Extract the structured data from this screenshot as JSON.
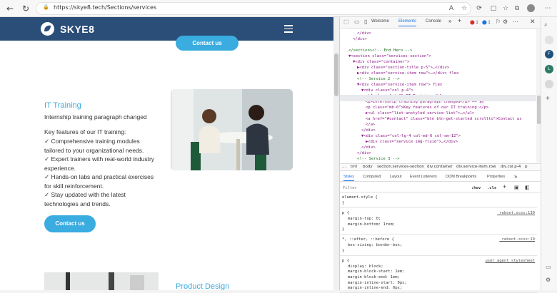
{
  "browser": {
    "url": "https://skye8.tech/Sections/services",
    "back_icon": "←",
    "reload_icon": "C",
    "read_icon": "Aᴀ"
  },
  "site": {
    "logo": "SKYE8",
    "top_button": "Contact us",
    "service1": {
      "title": "IT Training",
      "intro": "Internship training paragraph changed",
      "features_label": "Key features of our IT training:",
      "items": [
        "Comprehensive training modules tailored to your organizational needs.",
        "Expert trainers with real-world industry experience.",
        "Hands-on labs and practical exercises for skill reinforcement.",
        "Stay updated with the latest technologies and trends."
      ],
      "button": "Contact us"
    },
    "service2": {
      "title": "Product Design"
    }
  },
  "devtools": {
    "tabs": [
      "Welcome",
      "Elements",
      "Console"
    ],
    "errors": "1",
    "warnings": "1",
    "tree": [
      {
        "indent": 3,
        "text": "</div>"
      },
      {
        "indent": 2,
        "text": "</div>"
      },
      {
        "indent": 0,
        "text": ""
      },
      {
        "indent": 1,
        "text": "</section><!-- End Hero -->"
      },
      {
        "indent": 1,
        "text": "▼<section class=\"services-section\">"
      },
      {
        "indent": 2,
        "text": "▼<div class=\"container\">"
      },
      {
        "indent": 3,
        "text": "▶<div class=\"section-title p-5\">…</div>"
      },
      {
        "indent": 3,
        "text": "▶<div class=\"service-item row\">…</div> flex"
      },
      {
        "indent": 3,
        "text": "<!-- Service 2 -->"
      },
      {
        "indent": 3,
        "text": "▼<div class=\"service-item row\"> flex"
      },
      {
        "indent": 4,
        "text": "▼<div class=\"col p-4\">"
      },
      {
        "indent": 5,
        "text": "<h4 class=\"pt-2\">IT Training</h4>"
      },
      {
        "indent": 5,
        "text": "<p>Internship training paragraph changed</p> == $0"
      },
      {
        "indent": 5,
        "text": "<p class=\"mb-0\">Key features of our IT training:</p>"
      },
      {
        "indent": 5,
        "text": "▶<ul class=\"list-unstyled service-list\">…</ul>"
      },
      {
        "indent": 5,
        "text": "<a href=\"#contact\" class=\"btn btn-get-started scrollto\">Contact us"
      },
      {
        "indent": 5,
        "text": "</a>"
      },
      {
        "indent": 4,
        "text": "</div>"
      },
      {
        "indent": 4,
        "text": "▼<div class=\"col-lg-4 col-md-6 col-sm-12\">"
      },
      {
        "indent": 5,
        "text": "▶<div class=\"service img-fluid\">…</div>"
      },
      {
        "indent": 4,
        "text": "</div>"
      },
      {
        "indent": 3,
        "text": "</div>"
      },
      {
        "indent": 3,
        "text": "<!-- Service 3 -->"
      }
    ],
    "breadcrumbs": [
      "...",
      "tml",
      "body",
      "section.services-section",
      "div.container",
      "div.service-item.row",
      "div.col.p-4",
      "p"
    ],
    "style_tabs": [
      "Styles",
      "Computed",
      "Layout",
      "Event Listeners",
      "DOM Breakpoints",
      "Properties"
    ],
    "filter_placeholder": "Filter",
    "hov": ":hov",
    "cls": ".cls",
    "rules": [
      {
        "selector": "element.style {",
        "source": "",
        "decls": [],
        "close": "}"
      },
      {
        "selector": "p {",
        "source": "_reboot.scss:130",
        "decls": [
          "margin-top: 0;",
          "margin-bottom: 1rem;"
        ],
        "close": "}"
      },
      {
        "selector": "*, ::after, ::before {",
        "source": "_reboot.scss:19",
        "decls": [
          "box-sizing: border-box;"
        ],
        "close": "}"
      },
      {
        "selector": "p {",
        "source": "user agent stylesheet",
        "decls": [
          "display: block;",
          "margin-block-start: 1em;",
          "margin-block-end: 1em;",
          "margin-inline-start: 0px;",
          "margin-inline-end: 0px;"
        ],
        "close": ""
      }
    ]
  },
  "colors": {
    "header": "#2a4e78",
    "accent": "#3aace0"
  }
}
